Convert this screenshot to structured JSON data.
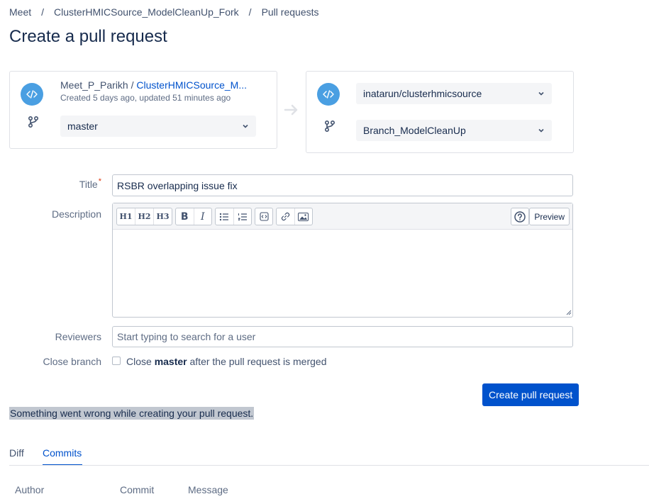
{
  "breadcrumb": {
    "items": [
      "Meet",
      "ClusterHMICSource_ModelCleanUp_Fork",
      "Pull requests"
    ],
    "separator": "/"
  },
  "page_title": "Create a pull request",
  "source": {
    "owner": "Meet_P_Parikh",
    "separator": " / ",
    "repo": "ClusterHMICSource_M...",
    "meta": "Created 5 days ago, updated 51 minutes ago",
    "branch": "master"
  },
  "target": {
    "repo": "inatarun/clusterhmicsource",
    "branch": "Branch_ModelCleanUp"
  },
  "form": {
    "title_label": "Title",
    "required_mark": "*",
    "title_value": "RSBR overlapping issue fix",
    "description_label": "Description",
    "toolbar": {
      "h1": "H1",
      "h2": "H2",
      "h3": "H3",
      "bold": "B",
      "italic": "I",
      "preview": "Preview"
    },
    "reviewers_label": "Reviewers",
    "reviewers_placeholder": "Start typing to search for a user",
    "close_branch_label": "Close branch",
    "close_prefix": "Close",
    "close_branch_name": "master",
    "close_suffix": "after the pull request is merged",
    "submit_label": "Create pull request"
  },
  "error_message": "Something went wrong while creating your pull request.",
  "tabs": [
    {
      "label": "Diff",
      "active": false
    },
    {
      "label": "Commits",
      "active": true
    }
  ],
  "commits_table": {
    "columns": [
      "Author",
      "Commit",
      "Message"
    ]
  },
  "colors": {
    "accent": "#0052cc",
    "repo_icon": "#4a9fe2",
    "required": "#de350b"
  }
}
